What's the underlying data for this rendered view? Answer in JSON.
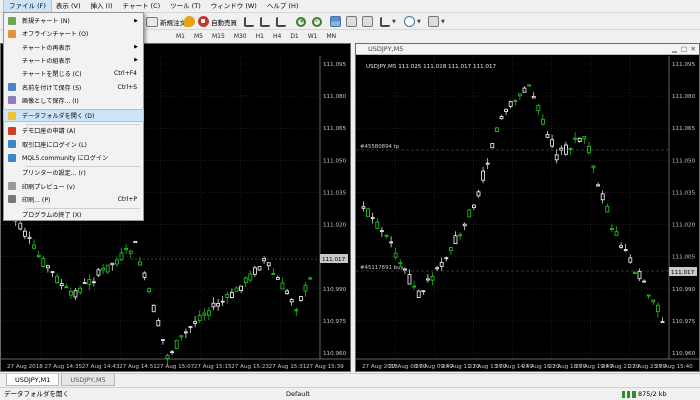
{
  "menubar": {
    "items": [
      {
        "label": "ファイル (F)",
        "active": true
      },
      {
        "label": "表示 (V)"
      },
      {
        "label": "挿入 (I)"
      },
      {
        "label": "チャート (C)"
      },
      {
        "label": "ツール (T)"
      },
      {
        "label": "ウィンドウ (W)"
      },
      {
        "label": "ヘルプ (H)"
      }
    ]
  },
  "toolbar": {
    "new_order_label": "新規注文",
    "autotrade_label": "自動売買"
  },
  "timeframes": [
    "M1",
    "M5",
    "M15",
    "M30",
    "H1",
    "H4",
    "D1",
    "W1",
    "MN"
  ],
  "file_menu": {
    "items": [
      {
        "label": "新規チャート (N)",
        "icon": "new-chart-icon",
        "arrow": true
      },
      {
        "label": "オフラインチャート (O)",
        "icon": "offline-chart-icon"
      },
      {
        "label": "チャートの再表示",
        "icon": "",
        "arrow": true
      },
      {
        "label": "チャートの組表示",
        "icon": "",
        "arrow": true
      },
      {
        "label": "チャートを閉じる (C)",
        "icon": "",
        "shortcut": "Ctrl+F4"
      },
      {
        "label": "名前を付けて保存 (S)",
        "icon": "save-icon",
        "shortcut": "Ctrl+S"
      },
      {
        "label": "画像として保存... (I)",
        "icon": "image-icon"
      },
      {
        "label": "データフォルダを開く (D)",
        "icon": "folder-icon",
        "highlight": true
      },
      {
        "label": "デモ口座の申請 (A)",
        "icon": "demo-account-icon"
      },
      {
        "label": "取引口座にログイン (L)",
        "icon": "login-icon"
      },
      {
        "label": "MQL5.community にログイン",
        "icon": "mql5-icon"
      },
      {
        "label": "プリンターの設定... (r)",
        "icon": ""
      },
      {
        "label": "印刷プレビュー (v)",
        "icon": "print-preview-icon"
      },
      {
        "label": "印刷... (P)",
        "icon": "print-icon",
        "shortcut": "Ctrl+P"
      },
      {
        "label": "プログラムの終了 (X)",
        "icon": ""
      }
    ]
  },
  "charts": {
    "m1": {
      "price_labels": [
        "111.095",
        "111.080",
        "111.065",
        "111.050",
        "111.035",
        "111.020",
        "111.005",
        "110.990",
        "110.975",
        "110.960"
      ],
      "current_price": "111.017",
      "time_labels": [
        "27 Aug 2018",
        "27 Aug 14:35",
        "27 Aug 14:43",
        "27 Aug 14:51",
        "27 Aug 15:07",
        "27 Aug 15:15",
        "27 Aug 15:23",
        "27 Aug 15:31",
        "27 Aug 15:39"
      ]
    },
    "m5": {
      "title": "USDJPY,M5",
      "header": "USDJPY,M5  111.025 111.028 111.017 111.017",
      "price_labels": [
        "111.095",
        "111.080",
        "111.065",
        "111.050",
        "111.035",
        "111.020",
        "111.005",
        "110.990",
        "110.975",
        "110.960"
      ],
      "current_price": "111.017",
      "order_lines": [
        "#45580894 tp",
        "#45117691 buy"
      ],
      "time_labels": [
        "27 Aug 2018",
        "27 Aug 08:00",
        "27 Aug 09:40",
        "27 Aug 11:20",
        "27 Aug 13:00",
        "27 Aug 14:40",
        "27 Aug 16:20",
        "27 Aug 18:00",
        "27 Aug 19:40",
        "27 Aug 21:20",
        "27 Aug 23:00",
        "27 Aug 15:40"
      ]
    }
  },
  "tabs": [
    "USDJPY,M1",
    "USDJPY,M5"
  ],
  "statusbar": {
    "left": "データフォルダを開く",
    "profile": "Default",
    "traffic": "875/2 kb"
  },
  "colors": {
    "chart_bg": "#000000",
    "candle_up": "#ffffff",
    "candle_down": "#00e000",
    "grid": "#3a3a3a",
    "menu_highlight": "#cce4f7"
  }
}
